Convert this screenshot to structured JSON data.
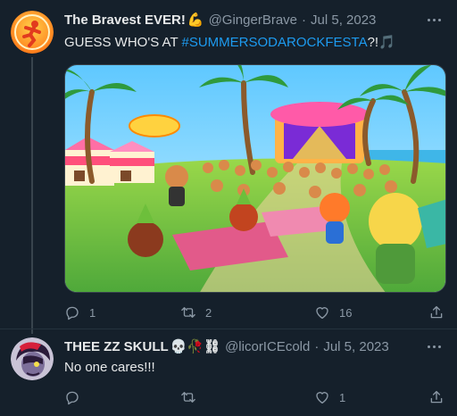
{
  "tweets": [
    {
      "name": "The Bravest EVER!",
      "name_emoji": "💪",
      "handle": "@GingerBrave",
      "separator": "·",
      "date": "Jul 5, 2023",
      "text_prefix": "GUESS WHO'S AT ",
      "hashtag": "#SUMMERSODAROCKFESTA",
      "text_suffix": "?!",
      "text_emoji": "🎵",
      "reply_count": "1",
      "retweet_count": "2",
      "like_count": "16",
      "share_count": ""
    },
    {
      "name": "THEE ZZ SKULL",
      "name_emoji": "💀🥀⛓",
      "handle": "@licorICEcold",
      "separator": "·",
      "date": "Jul 5, 2023",
      "text": "No one cares!!!",
      "reply_count": "",
      "retweet_count": "",
      "like_count": "1",
      "share_count": ""
    }
  ],
  "colors": {
    "background": "#15202b",
    "text": "#e7e9ea",
    "secondary": "#8b98a5",
    "link": "#1d9bf0",
    "divider": "#38444d"
  },
  "icons": [
    "more-icon",
    "reply-icon",
    "retweet-icon",
    "like-icon",
    "share-icon"
  ]
}
